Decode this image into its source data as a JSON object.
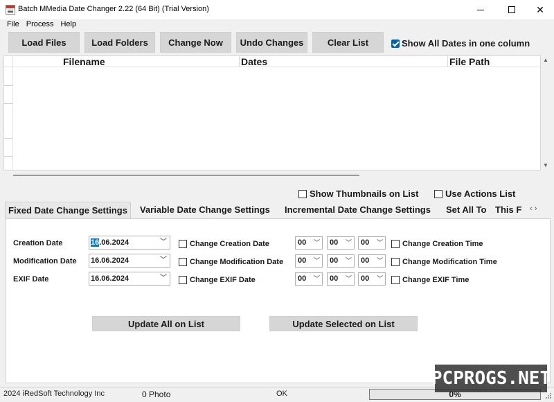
{
  "window": {
    "title": "Batch MMedia Date Changer 2.22 (64 Bit) (Trial Version)",
    "minimize": "–",
    "maximize": "",
    "close": "✕"
  },
  "menu": [
    "File",
    "Process",
    "Help"
  ],
  "toolbar": {
    "load_files": "Load Files",
    "load_folders": "Load Folders",
    "change_now": "Change Now",
    "undo_changes": "Undo Changes",
    "clear_list": "Clear List",
    "show_all_dates": "Show All Dates in one column",
    "show_all_dates_checked": true
  },
  "grid": {
    "columns": [
      "Filename",
      "Dates",
      "File Path"
    ],
    "rows": []
  },
  "options": {
    "show_thumbnails": "Show Thumbnails on List",
    "use_actions": "Use Actions List"
  },
  "tabs": [
    "Fixed Date Change Settings",
    "Variable Date Change Settings",
    "Incremental Date Change Settings",
    "Set All To",
    "This F"
  ],
  "tab_arrows": "‹ ›",
  "fields": {
    "creation": {
      "label": "Creation Date",
      "date_sel": "16",
      "date_rest": ".06.2024",
      "change_date_label": "Change Creation Date",
      "hh": "00",
      "mm": "00",
      "ss": "00",
      "change_time_label": "Change Creation Time"
    },
    "modification": {
      "label": "Modification Date",
      "date": "16.06.2024",
      "change_date_label": "Change Modification Date",
      "hh": "00",
      "mm": "00",
      "ss": "00",
      "change_time_label": "Change Modification Time"
    },
    "exif": {
      "label": "EXIF Date",
      "date": "16.06.2024",
      "change_date_label": "Change EXIF Date",
      "hh": "00",
      "mm": "00",
      "ss": "00",
      "change_time_label": "Change EXIF Time"
    }
  },
  "actions": {
    "update_all": "Update All on List",
    "update_selected": "Update Selected on List"
  },
  "status": {
    "copyright": "2024 iRedSoft Technology Inc",
    "photo_count": "0 Photo",
    "state": "OK",
    "progress_text": "0%",
    "progress_value": 0
  },
  "watermark": "PCPROGS.NET",
  "colors": {
    "accent": "#0063b1",
    "button_bg": "#d6d6d6",
    "progress_fill": "#06b025"
  }
}
